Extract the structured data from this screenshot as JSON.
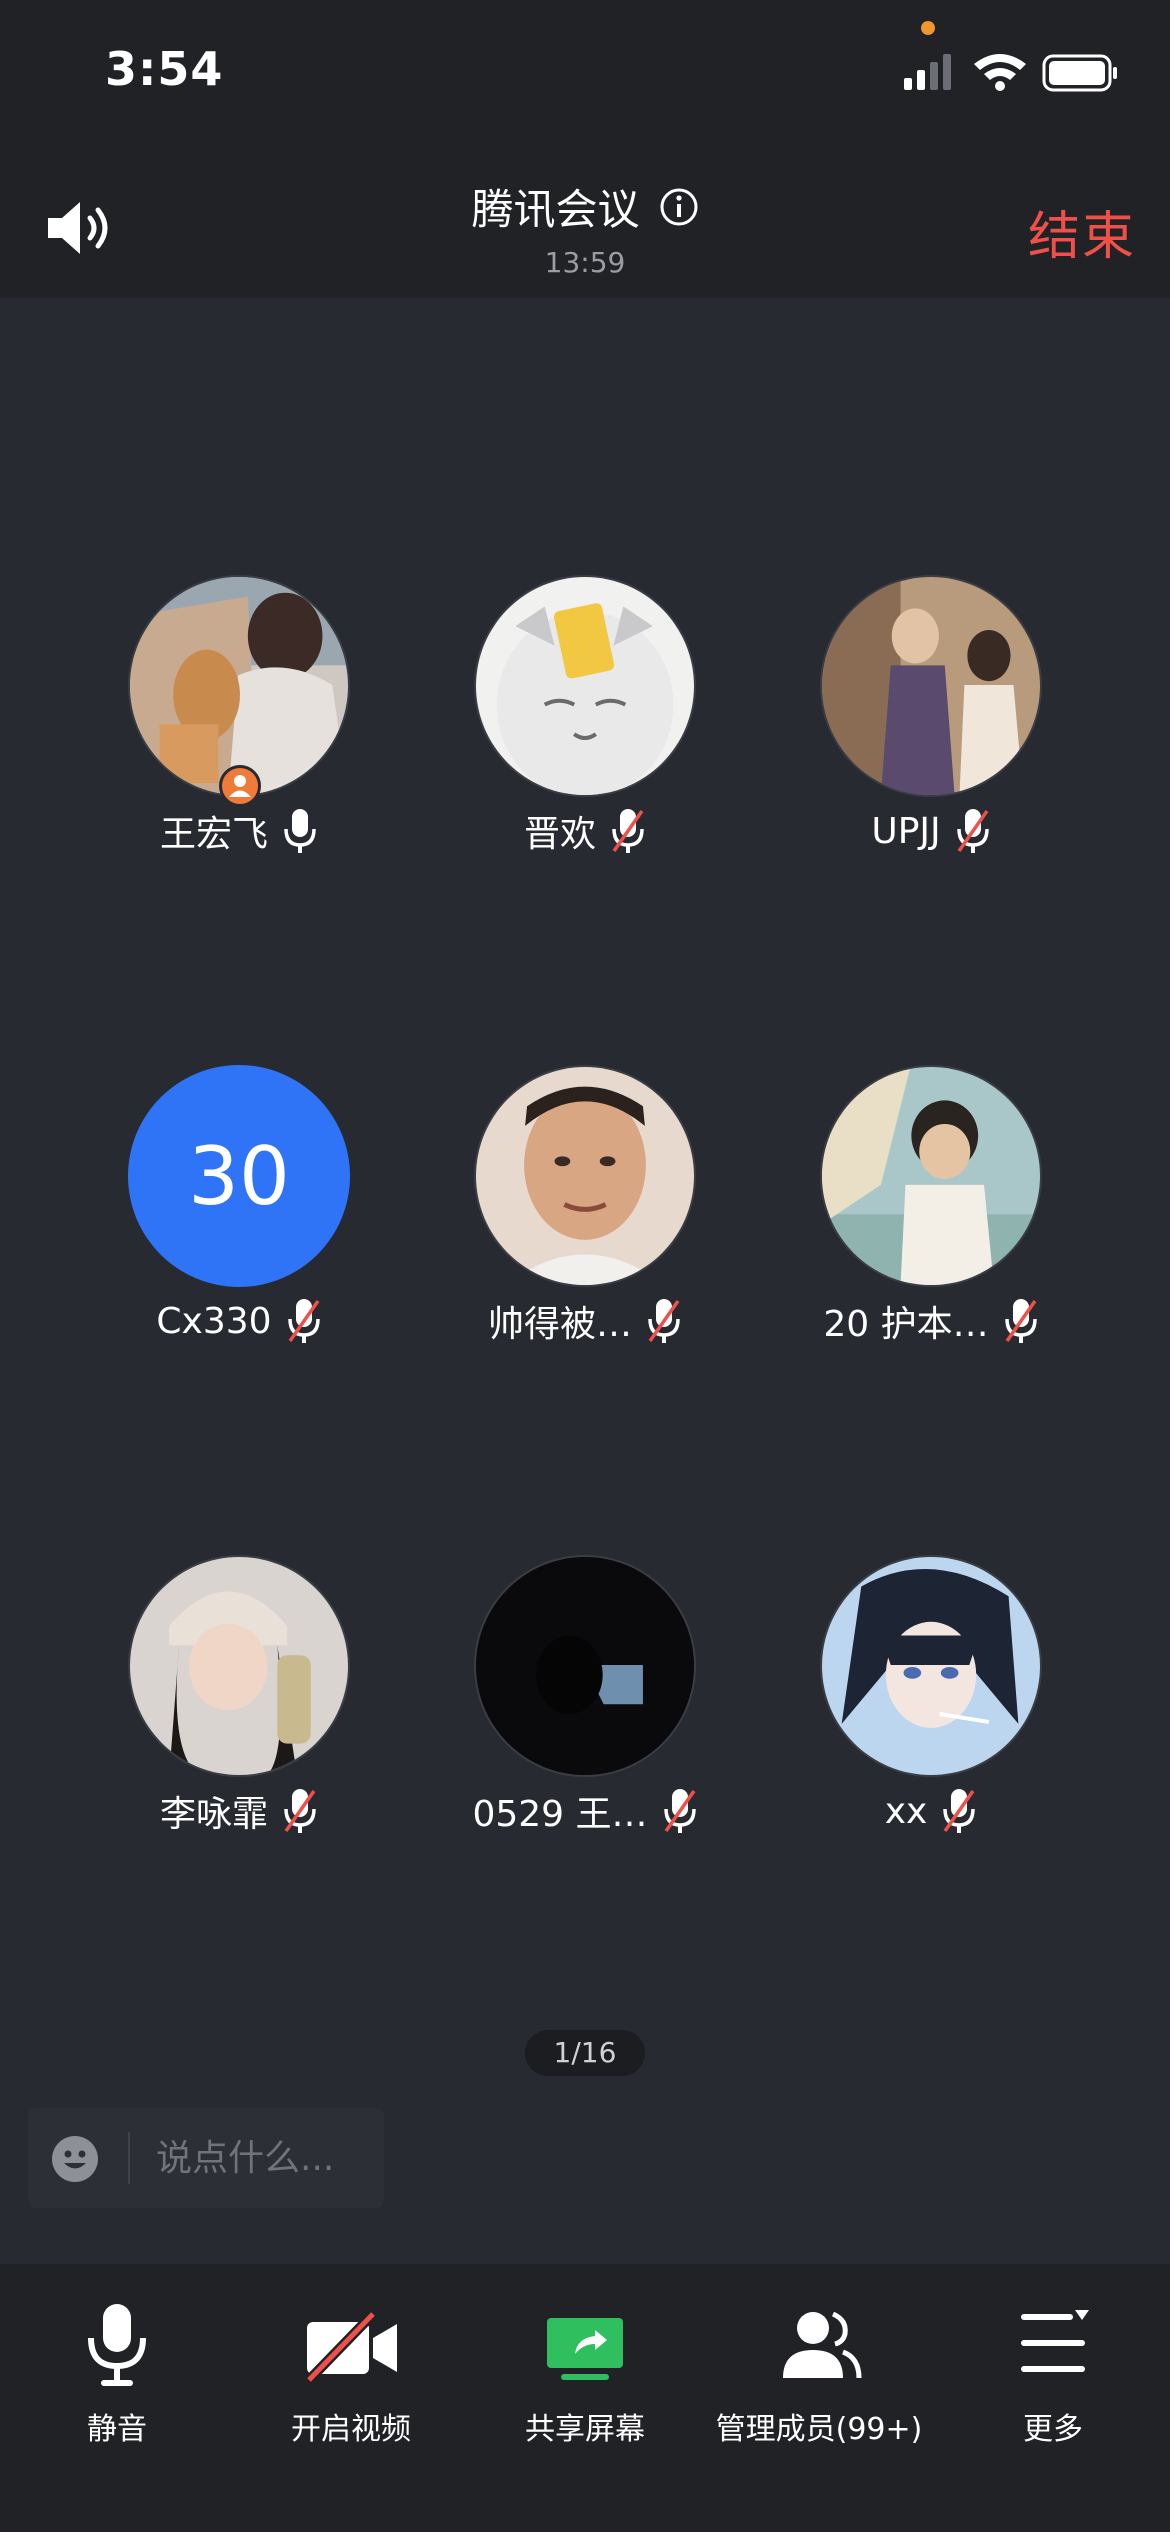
{
  "status_bar": {
    "time": "3:54"
  },
  "header": {
    "title": "腾讯会议",
    "elapsed": "13:59",
    "end_label": "结束"
  },
  "participants": [
    {
      "name": "王宏飞",
      "mic": "on",
      "host": true,
      "avatar": "photo"
    },
    {
      "name": "晋欢",
      "mic": "muted",
      "avatar": "photo"
    },
    {
      "name": "UPJJ",
      "mic": "muted",
      "avatar": "photo"
    },
    {
      "name": "Cx330",
      "mic": "muted",
      "avatar_text": "30",
      "avatar_color": "#2f74f6"
    },
    {
      "name": "帅得被…",
      "mic": "muted",
      "avatar": "photo"
    },
    {
      "name": "20 护本…",
      "mic": "muted",
      "avatar": "photo"
    },
    {
      "name": "李咏霏",
      "mic": "muted",
      "avatar": "photo"
    },
    {
      "name": "0529 王…",
      "mic": "muted",
      "avatar": "photo"
    },
    {
      "name": "xx",
      "mic": "muted",
      "avatar": "photo"
    }
  ],
  "pager": "1/16",
  "chat": {
    "placeholder": "说点什么..."
  },
  "toolbar": [
    {
      "label": "静音",
      "icon": "microphone-icon"
    },
    {
      "label": "开启视频",
      "icon": "video-off-icon"
    },
    {
      "label": "共享屏幕",
      "icon": "share-screen-icon",
      "accent": "#2fbf5f"
    },
    {
      "label": "管理成员(99+)",
      "icon": "members-icon"
    },
    {
      "label": "更多",
      "icon": "more-icon"
    }
  ],
  "colors": {
    "end": "#f0504a",
    "muted": "#f0504a",
    "accent_green": "#2fbf5f",
    "avatar_blue": "#2f74f6"
  }
}
